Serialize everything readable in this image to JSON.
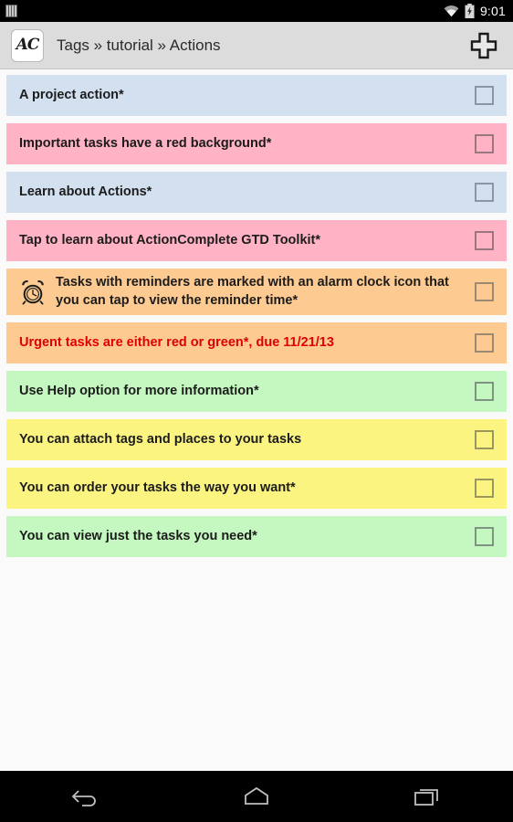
{
  "status_bar": {
    "sim_icon": "sim-bars-icon",
    "wifi_icon": "wifi-icon",
    "battery_icon": "battery-charging-icon",
    "time": "9:01"
  },
  "action_bar": {
    "logo_text": "AC",
    "logo_icon": "app-logo-icon",
    "breadcrumb": "Tags » tutorial » Actions",
    "add_icon": "plus-icon"
  },
  "colors": {
    "blue": "#d3e0f0",
    "pink": "#ffb3c4",
    "orange": "#fdcb92",
    "green": "#c5f8c0",
    "yellow": "#fcf481",
    "urgent_text": "#e00000",
    "page_background": "#fafafa",
    "action_bar": "#dcdcdc",
    "system_bar": "#000000"
  },
  "tasks": [
    {
      "label": "A project action*",
      "color": "blue",
      "icon": null,
      "checked": false,
      "urgent": false
    },
    {
      "label": "Important tasks have a red background*",
      "color": "pink",
      "icon": null,
      "checked": false,
      "urgent": false
    },
    {
      "label": "Learn about Actions*",
      "color": "blue",
      "icon": null,
      "checked": false,
      "urgent": false
    },
    {
      "label": "Tap to learn about ActionComplete GTD Toolkit*",
      "color": "pink",
      "icon": null,
      "checked": false,
      "urgent": false
    },
    {
      "label": "Tasks with reminders are marked with an alarm clock icon that you can tap to view the reminder time*",
      "color": "orange",
      "icon": "alarm-clock-icon",
      "checked": false,
      "urgent": false
    },
    {
      "label": "Urgent tasks are either red or green*, due 11/21/13",
      "color": "orange",
      "icon": null,
      "checked": false,
      "urgent": true
    },
    {
      "label": "Use Help option for more information*",
      "color": "green",
      "icon": null,
      "checked": false,
      "urgent": false
    },
    {
      "label": "You can attach tags and places to your tasks",
      "color": "yellow",
      "icon": null,
      "checked": false,
      "urgent": false
    },
    {
      "label": "You can order your tasks the way you want*",
      "color": "yellow",
      "icon": null,
      "checked": false,
      "urgent": false
    },
    {
      "label": "You can view just the tasks you need*",
      "color": "green",
      "icon": null,
      "checked": false,
      "urgent": false
    }
  ],
  "nav_bar": {
    "back_icon": "back-arrow-icon",
    "home_icon": "home-icon",
    "recents_icon": "recent-apps-icon"
  }
}
